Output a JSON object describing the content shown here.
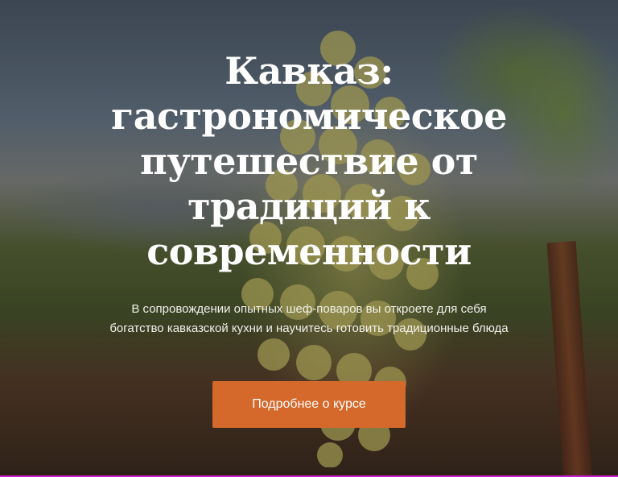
{
  "hero": {
    "title": "Кавказ: гастрономическое путешествие от традиций к современности",
    "subtitle": "В сопровождении опытных шеф-поваров вы откроете для себя богатство кавказской кухни и научитесь готовить традиционные блюда",
    "button_label": "Подробнее о курсе"
  },
  "colors": {
    "accent": "#d5692b",
    "title_text": "#ffffff",
    "bottom_line": "#c21fc6"
  }
}
